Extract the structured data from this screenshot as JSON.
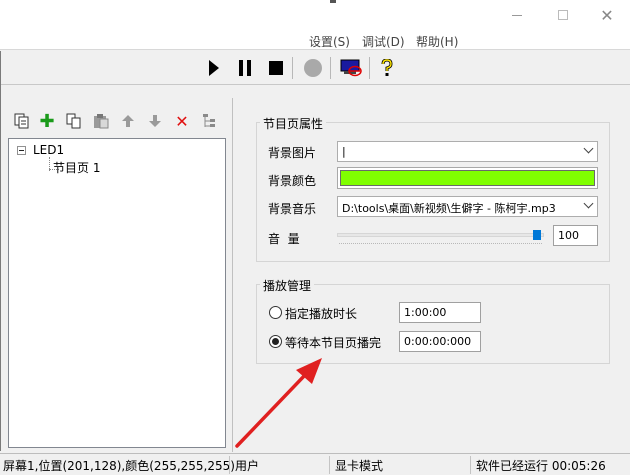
{
  "window": {
    "min_glyph": "—",
    "close_glyph": "✕"
  },
  "menu": {
    "items": [
      "设置(S)",
      "调试(D)",
      "帮助(H)"
    ]
  },
  "toolbar": {
    "play_icon": "play-icon",
    "pause_icon": "pause-icon",
    "stop_icon": "stop-icon",
    "record_icon": "record-icon",
    "screen_off_icon": "screen-off-icon",
    "help_icon": "help-icon"
  },
  "left_panel": {
    "tools": [
      "copy-icon",
      "add-icon",
      "duplicate-icon",
      "paste-icon",
      "move-up-icon",
      "move-down-icon",
      "delete-icon",
      "tree-icon"
    ],
    "add_glyph": "✚",
    "delete_glyph": "✕",
    "up_glyph": "🡅",
    "down_glyph": "🡇",
    "tree": {
      "root": "LED1",
      "child": "节目页 1"
    }
  },
  "program_props": {
    "title": "节目页属性",
    "bg_image_label": "背景图片",
    "bg_image_value": "|",
    "bg_color_label": "背景颜色",
    "bg_color": "#80ff00",
    "bg_music_label": "背景音乐",
    "bg_music_value": "D:\\tools\\桌面\\新视频\\生僻字 - 陈柯宇.mp3",
    "volume_label": "音  量",
    "volume_value": "100",
    "volume_fraction": 1.0
  },
  "playback": {
    "title": "播放管理",
    "option1_label": "指定播放时长",
    "option1_value": "1:00:00",
    "option2_label": "等待本节目页播完",
    "option2_value": "0:00:00:000",
    "selected": 2
  },
  "statusbar": {
    "screen_info": "屏幕1,位置(201,128),颜色(255,255,255)",
    "user": "用户",
    "mode": "显卡模式",
    "runtime": "软件已经运行 00:05:26"
  },
  "annotation": {
    "arrow_color": "#e02020"
  }
}
